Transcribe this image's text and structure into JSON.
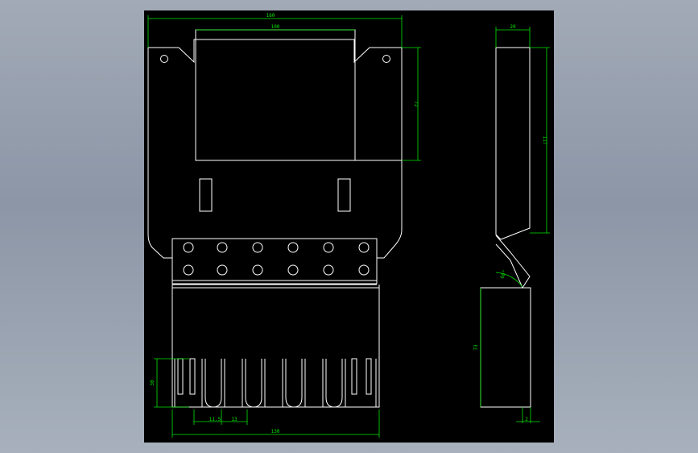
{
  "drawing": {
    "colors": {
      "background": "#000000",
      "outline": "#ffffff",
      "dimension": "#00e600",
      "gradient_top": "#a2aab7",
      "gradient_bottom": "#a7b0bc"
    },
    "dimensions": {
      "overall_width": "160",
      "window_width": "100",
      "window_height": "72",
      "side_depth": "20",
      "side_height": "117",
      "bend_angle": "60°",
      "lower_height": "73",
      "thickness": "2",
      "slot_height": "30",
      "slot_pitch": "11.5",
      "slot_width": "13",
      "lower_width": "130"
    }
  }
}
